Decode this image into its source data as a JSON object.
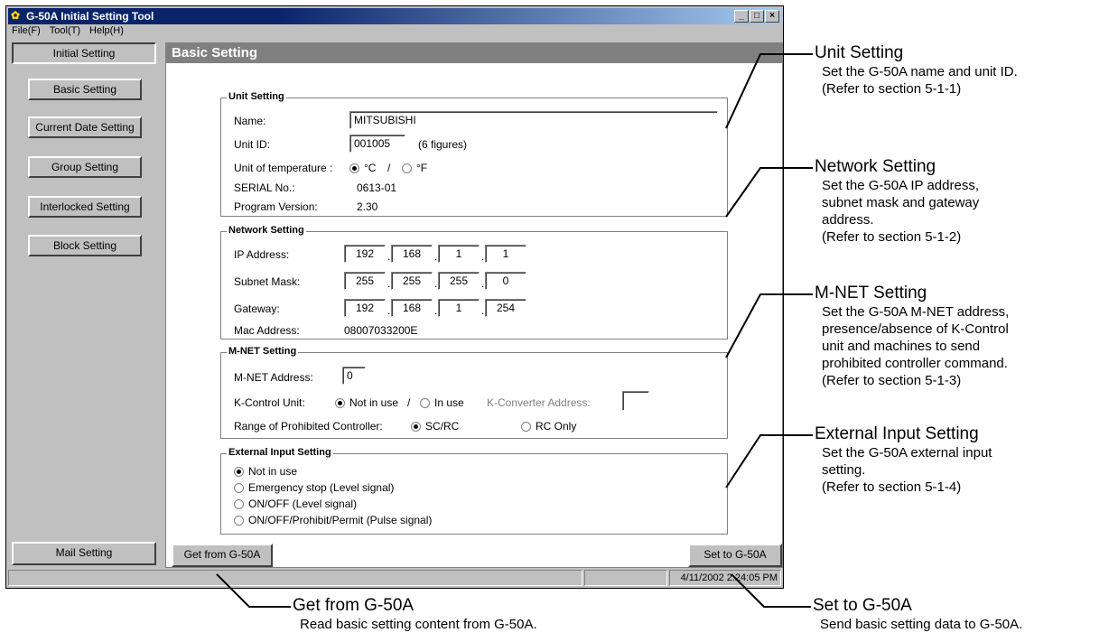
{
  "window": {
    "title": "G-50A Initial Setting Tool",
    "buttons": [
      "_",
      "□",
      "×"
    ]
  },
  "menu": [
    "File(F)",
    "Tool(T)",
    "Help(H)"
  ],
  "sidebar": {
    "header": "Initial Setting",
    "items": [
      {
        "label": "Basic Setting"
      },
      {
        "label": "Current Date Setting"
      },
      {
        "label": "Group Setting"
      },
      {
        "label": "Interlocked Setting"
      },
      {
        "label": "Block Setting"
      }
    ],
    "mail": "Mail Setting"
  },
  "main": {
    "header": "Basic Setting",
    "unit": {
      "title": "Unit Setting",
      "name_label": "Name:",
      "name_value": "MITSUBISHI",
      "id_label": "Unit ID:",
      "id_value": "001005",
      "id_hint": "(6 figures)",
      "temp_label": "Unit of temperature :",
      "temp_c": "°C",
      "temp_sep": "/",
      "temp_f": "°F",
      "serial_label": "SERIAL No.:",
      "serial_value": "0613-01",
      "version_label": "Program Version:",
      "version_value": "2.30"
    },
    "network": {
      "title": "Network Setting",
      "ip_label": "IP Address:",
      "ip": [
        "192",
        "168",
        "1",
        "1"
      ],
      "mask_label": "Subnet Mask:",
      "mask": [
        "255",
        "255",
        "255",
        "0"
      ],
      "gw_label": "Gateway:",
      "gw": [
        "192",
        "168",
        "1",
        "254"
      ],
      "mac_label": "Mac Address:",
      "mac_value": "08007033200E"
    },
    "mnet": {
      "title": "M-NET Setting",
      "addr_label": "M-NET Address:",
      "addr_value": "0",
      "kctl_label": "K-Control Unit:",
      "kctl_notinuse": "Not in use",
      "kctl_sep": "/",
      "kctl_inuse": "In use",
      "kconv_label": "K-Converter Address:",
      "kconv_value": "",
      "range_label": "Range of Prohibited Controller:",
      "range_scrc": "SC/RC",
      "range_rc": "RC Only"
    },
    "external": {
      "title": "External Input Setting",
      "options": [
        "Not in use",
        "Emergency stop (Level signal)",
        "ON/OFF (Level signal)",
        "ON/OFF/Prohibit/Permit (Pulse signal)"
      ]
    },
    "get_button": "Get from G-50A",
    "set_button": "Set to G-50A"
  },
  "statusbar": {
    "datetime": "4/11/2002 2:24:05 PM"
  },
  "callouts": {
    "unit": {
      "title": "Unit Setting",
      "desc": [
        "Set the G-50A name and unit ID.",
        "(Refer to section 5-1-1)"
      ]
    },
    "network": {
      "title": "Network Setting",
      "desc": [
        "Set the G-50A IP address,",
        "subnet mask and gateway",
        "address.",
        "(Refer to section 5-1-2)"
      ]
    },
    "mnet": {
      "title": "M-NET Setting",
      "desc": [
        "Set the G-50A M-NET address,",
        "presence/absence of K-Control",
        "unit and machines to send",
        "prohibited controller command.",
        "(Refer to section 5-1-3)"
      ]
    },
    "external": {
      "title": "External Input Setting",
      "desc": [
        "Set the G-50A external input",
        "setting.",
        "(Refer to section 5-1-4)"
      ]
    },
    "get": {
      "title": "Get from G-50A",
      "desc": [
        "Read basic setting content from G-50A."
      ]
    },
    "set": {
      "title": "Set to G-50A",
      "desc": [
        "Send basic setting data to G-50A."
      ]
    }
  }
}
